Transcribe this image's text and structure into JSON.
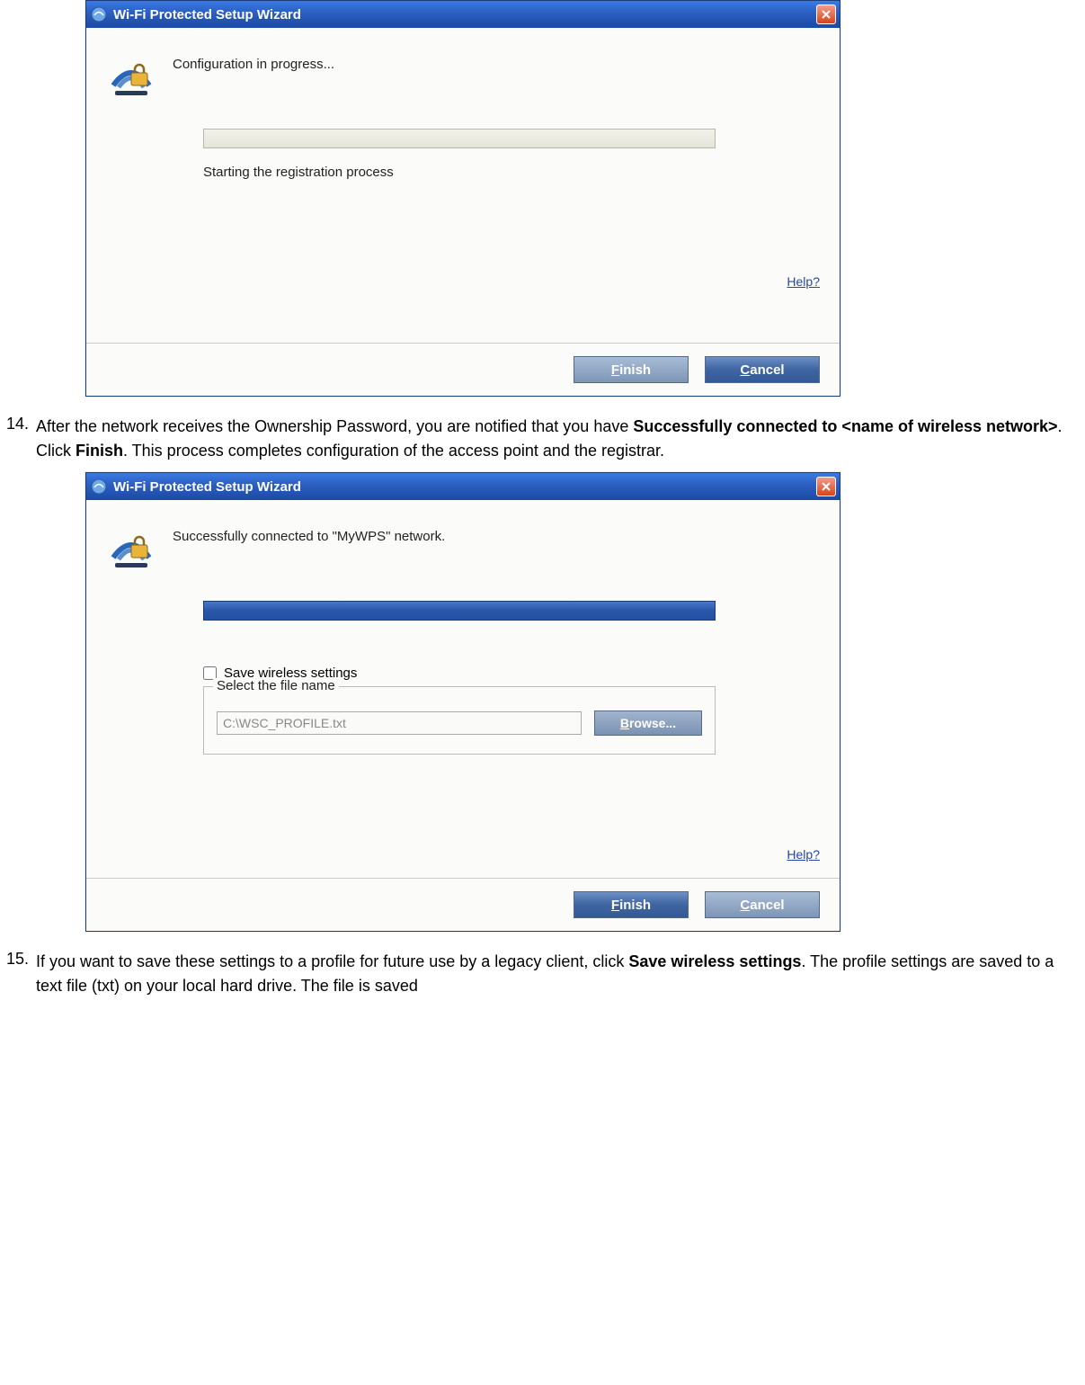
{
  "dialog1": {
    "title": "Wi-Fi Protected Setup Wizard",
    "heading": "Configuration in progress...",
    "status": "Starting the registration process",
    "help": "Help?",
    "finish_label": "Finish",
    "finish_key": "F",
    "cancel_label": "Cancel",
    "cancel_key": "C"
  },
  "step14": {
    "num": "14.",
    "text_a": "After the network receives the Ownership Password, you are notified that you have ",
    "bold_a": "Successfully connected to <name of wireless network>",
    "text_b": ". Click ",
    "bold_b": "Finish",
    "text_c": ". This process completes configuration of the access point and the registrar."
  },
  "dialog2": {
    "title": "Wi-Fi Protected Setup Wizard",
    "heading": "Successfully connected to \"MyWPS\" network.",
    "save_checkbox_label": "Save wireless settings",
    "fieldset_legend": "Select the file name",
    "file_path": "C:\\WSC_PROFILE.txt",
    "browse_label": "Browse...",
    "browse_key": "B",
    "help": "Help?",
    "finish_label": "Finish",
    "finish_key": "F",
    "cancel_label": "Cancel",
    "cancel_key": "C"
  },
  "step15": {
    "num": "15.",
    "text_a": "If you want to save these settings to a profile for future use by a legacy client, click ",
    "bold_a": "Save wireless settings",
    "text_b": ". The profile settings are saved to a text file (txt) on your local hard drive. The file is saved"
  }
}
